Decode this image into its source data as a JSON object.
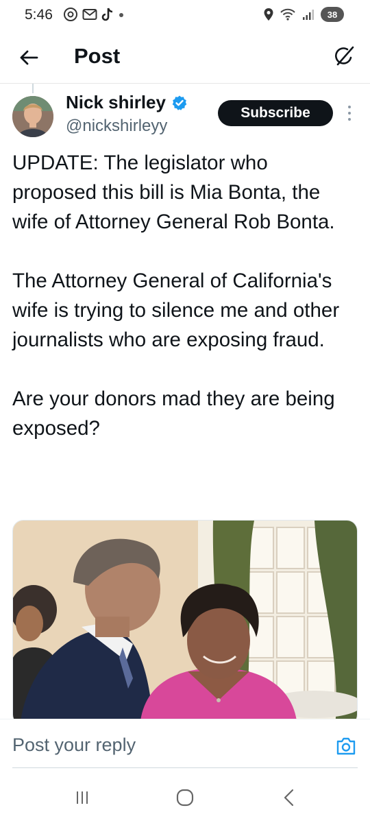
{
  "status_bar": {
    "time": "5:46",
    "battery": "38",
    "left_icons": [
      "threads-icon",
      "mail-icon",
      "tiktok-icon",
      "dot-icon"
    ],
    "right_icons": [
      "location-icon",
      "wifi-icon",
      "signal-icon",
      "battery-icon"
    ]
  },
  "header": {
    "title": "Post",
    "back_icon": "arrow-left-icon",
    "grok_icon": "grok-icon"
  },
  "post": {
    "author": {
      "name": "Nick shirley",
      "handle": "@nickshirleyy",
      "verified": true
    },
    "subscribe_label": "Subscribe",
    "paragraphs": [
      "UPDATE: The legislator who proposed this bill is Mia Bonta, the wife of Attorney General Rob Bonta.",
      "The Attorney General of California's wife is trying to silence me and other journalists who are exposing fraud.",
      "Are your donors mad they are being exposed?"
    ]
  },
  "reply": {
    "placeholder": "Post your reply",
    "camera_icon": "camera-icon"
  },
  "nav": {
    "items": [
      "recents-icon",
      "home-icon",
      "back-icon"
    ]
  },
  "colors": {
    "accent": "#1d9bf0",
    "text": "#0f1419",
    "secondary": "#536471",
    "subscribe_bg": "#0f1419"
  }
}
